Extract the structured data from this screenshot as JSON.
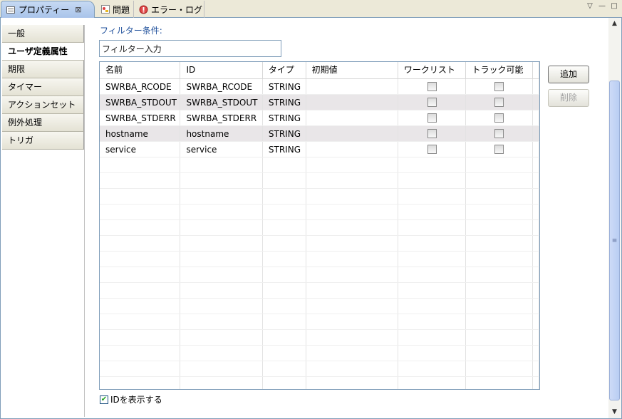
{
  "tabs": [
    {
      "label": "プロパティー",
      "active": true,
      "close": "⊠"
    },
    {
      "label": "問題",
      "active": false
    },
    {
      "label": "エラー・ログ",
      "active": false
    }
  ],
  "view_controls": [
    "▽",
    "—",
    "□"
  ],
  "categories": [
    "一般",
    "ユーザ定義属性",
    "期限",
    "タイマー",
    "アクションセット",
    "例外処理",
    "トリガ"
  ],
  "selected_category": "ユーザ定義属性",
  "filter": {
    "label": "フィルター条件:",
    "value": "フィルター入力"
  },
  "table": {
    "columns": [
      "名前",
      "ID",
      "タイプ",
      "初期値",
      "ワークリスト",
      "トラック可能"
    ],
    "rows": [
      {
        "name": "SWRBA_RCODE",
        "id": "SWRBA_RCODE",
        "type": "STRING",
        "initial": "",
        "worklist": false,
        "trackable": false
      },
      {
        "name": "SWRBA_STDOUT",
        "id": "SWRBA_STDOUT",
        "type": "STRING",
        "initial": "",
        "worklist": false,
        "trackable": false
      },
      {
        "name": "SWRBA_STDERR",
        "id": "SWRBA_STDERR",
        "type": "STRING",
        "initial": "",
        "worklist": false,
        "trackable": false
      },
      {
        "name": "hostname",
        "id": "hostname",
        "type": "STRING",
        "initial": "",
        "worklist": false,
        "trackable": false
      },
      {
        "name": "service",
        "id": "service",
        "type": "STRING",
        "initial": "",
        "worklist": false,
        "trackable": false
      }
    ]
  },
  "buttons": {
    "add": "追加",
    "delete": "削除"
  },
  "show_id": {
    "label": "IDを表示する",
    "checked": true
  }
}
